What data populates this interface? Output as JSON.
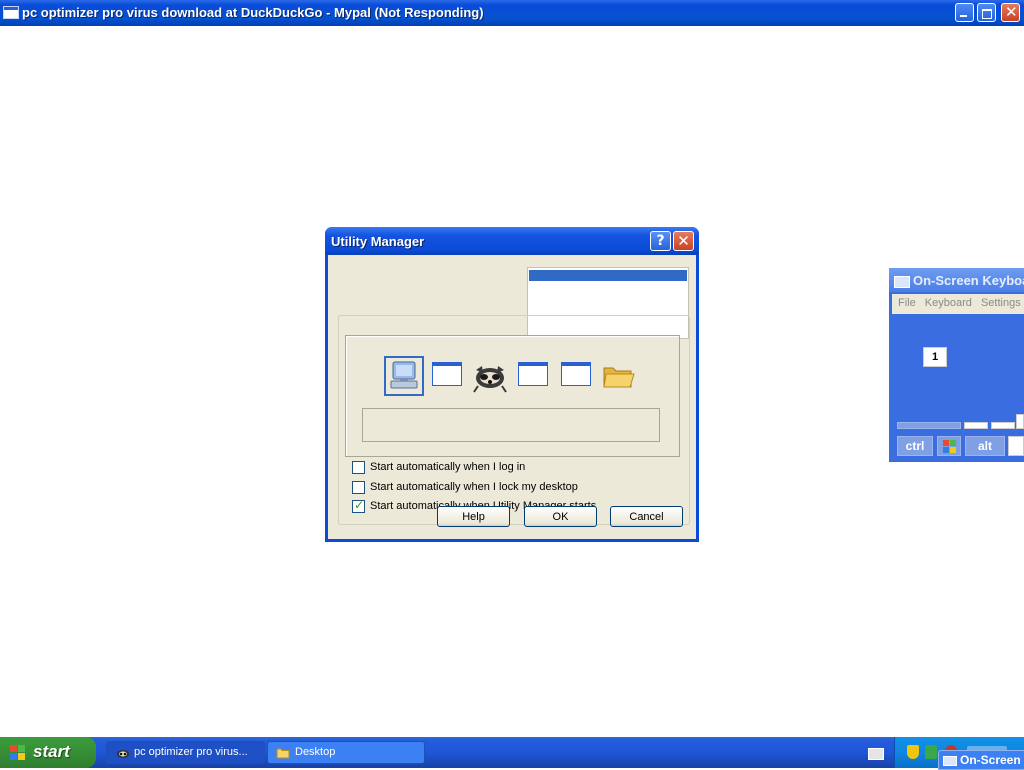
{
  "main_window": {
    "title": "pc optimizer pro virus download at DuckDuckGo - Mypal (Not Responding)"
  },
  "dialog": {
    "title": "Utility Manager",
    "help_glyph": "?",
    "close_glyph": "✕",
    "checkboxes": [
      {
        "label": "Start automatically when I log in",
        "checked": false
      },
      {
        "label": "Start automatically when I lock my desktop",
        "checked": false
      },
      {
        "label": "Start automatically when Utility Manager starts",
        "checked": true
      }
    ],
    "buttons": {
      "help": "Help",
      "ok": "OK",
      "cancel": "Cancel"
    }
  },
  "switcher": {
    "icons": [
      "on-screen-keyboard-icon",
      "window-icon",
      "raccoon-icon",
      "window-icon",
      "window-icon",
      "folder-icon"
    ],
    "selected_index": 0
  },
  "osk": {
    "title": "On-Screen Keyboard",
    "menu": [
      "File",
      "Keyboard",
      "Settings"
    ],
    "keys": {
      "one": "1",
      "ctrl": "ctrl",
      "alt": "alt"
    }
  },
  "taskbar": {
    "start_label": "start",
    "tasks": [
      {
        "label": "pc optimizer pro virus...",
        "icon": "raccoon-icon"
      },
      {
        "label": "Desktop",
        "icon": "folder-icon"
      }
    ],
    "osk_task_label": "On-Screen"
  }
}
